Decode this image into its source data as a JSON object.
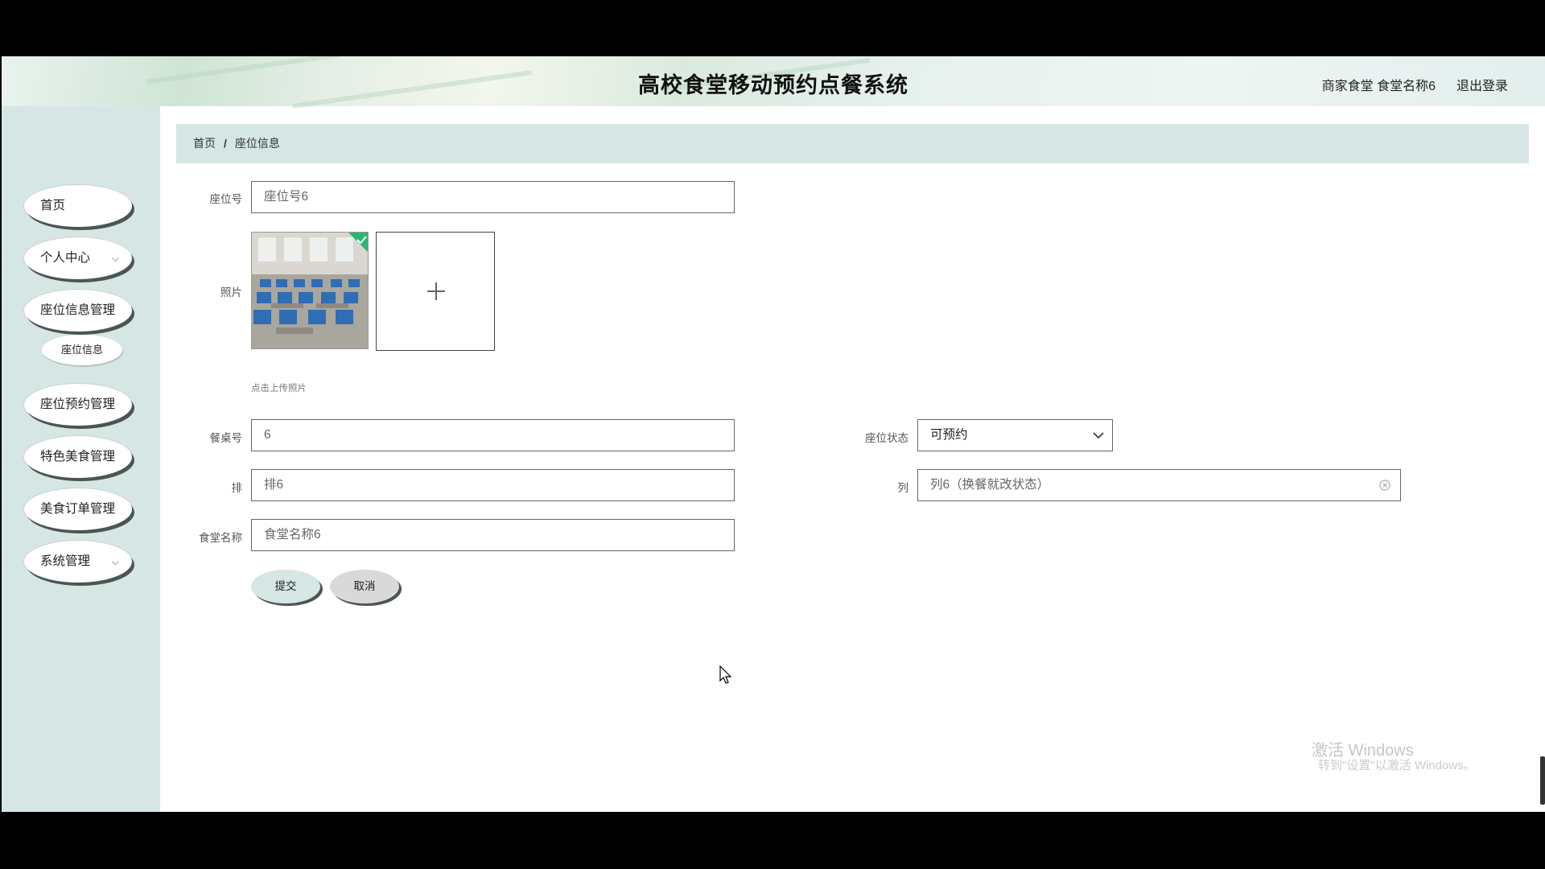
{
  "header": {
    "title": "高校食堂移动预约点餐系统",
    "user_info": "商家食堂 食堂名称6",
    "logout": "退出登录"
  },
  "sidebar": {
    "items": [
      {
        "label": "首页"
      },
      {
        "label": "个人中心",
        "chevron": "⌵"
      },
      {
        "label": "座位信息管理"
      },
      {
        "label": "座位信息"
      },
      {
        "label": "座位预约管理"
      },
      {
        "label": "特色美食管理"
      },
      {
        "label": "美食订单管理"
      },
      {
        "label": "系统管理",
        "chevron": "⌵"
      }
    ]
  },
  "breadcrumb": {
    "home": "首页",
    "separator": "/",
    "current": "座位信息"
  },
  "form": {
    "seat_no": {
      "label": "座位号",
      "value": "座位号6"
    },
    "photo": {
      "label": "照片",
      "hint": "点击上传照片",
      "thumb_alt": "canteen seating photo"
    },
    "table_no": {
      "label": "餐桌号",
      "value": "6"
    },
    "seat_status": {
      "label": "座位状态",
      "value": "可预约"
    },
    "row": {
      "label": "排",
      "value": "排6"
    },
    "column": {
      "label": "列",
      "value": "列6（换餐就改状态）"
    },
    "canteen_name": {
      "label": "食堂名称",
      "value": "食堂名称6"
    },
    "submit": "提交",
    "cancel": "取消"
  },
  "watermark": {
    "line1": "激活 Windows",
    "line2": "转到\"设置\"以激活 Windows。"
  },
  "colors": {
    "sidebar_bg": "#d6e6e4",
    "breadcrumb_bg": "#d6e6e4",
    "submit_bg": "#d6e6e4",
    "cancel_bg": "#d9d9d9"
  }
}
